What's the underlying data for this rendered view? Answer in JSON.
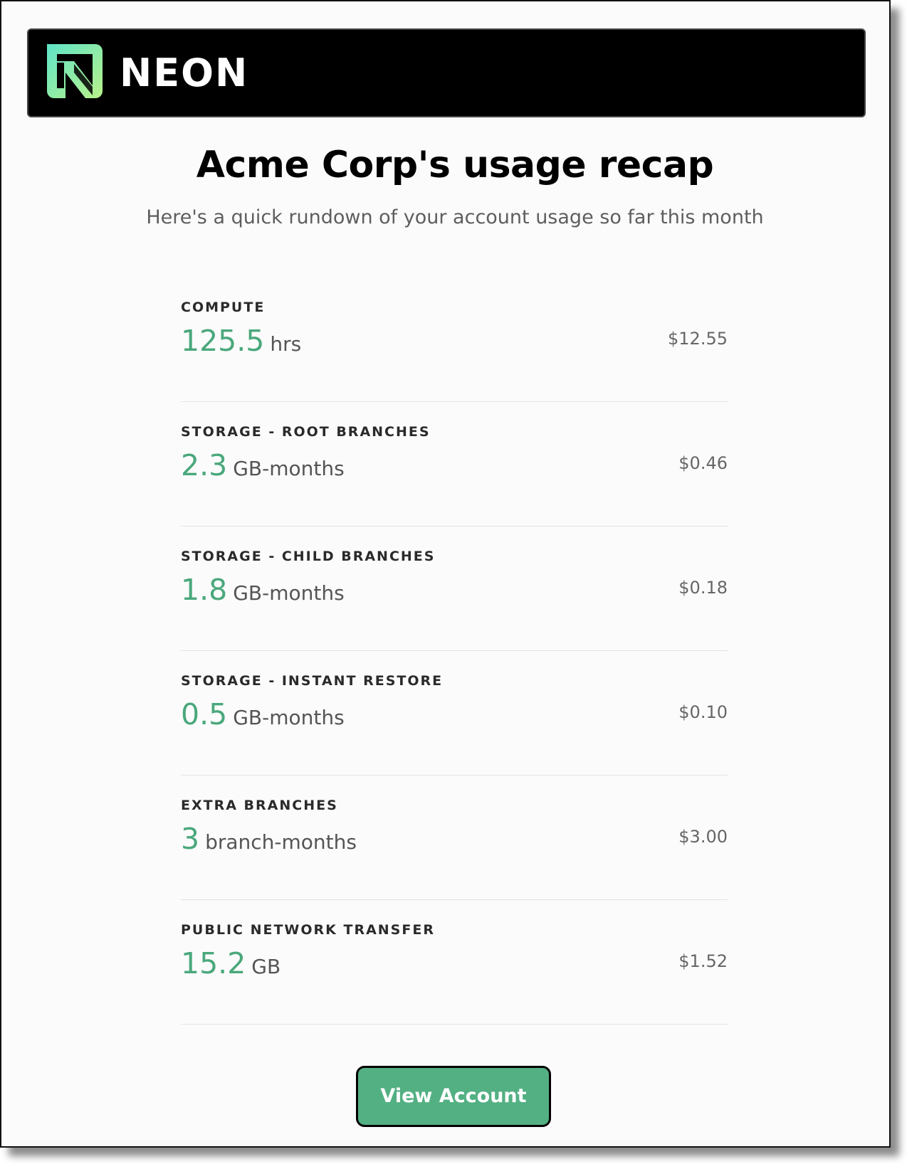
{
  "brand": {
    "name": "NEON",
    "logo_icon": "neon-n-logo-icon",
    "colors": {
      "header_bg": "#000000",
      "accent_green": "#4aa87c",
      "button_bg": "#53b083",
      "logo_gradient_start": "#5fe4c8",
      "logo_gradient_end": "#b8f28a"
    }
  },
  "title": "Acme Corp's usage recap",
  "subtitle": "Here's a quick rundown of your account usage so far this month",
  "usage": [
    {
      "label": "COMPUTE",
      "value": "125.5",
      "unit": "hrs",
      "cost": "$12.55"
    },
    {
      "label": "STORAGE - ROOT BRANCHES",
      "value": "2.3",
      "unit": "GB-months",
      "cost": "$0.46"
    },
    {
      "label": "STORAGE - CHILD BRANCHES",
      "value": "1.8",
      "unit": "GB-months",
      "cost": "$0.18"
    },
    {
      "label": "STORAGE - INSTANT RESTORE",
      "value": "0.5",
      "unit": "GB-months",
      "cost": "$0.10"
    },
    {
      "label": "EXTRA BRANCHES",
      "value": "3",
      "unit": "branch-months",
      "cost": "$3.00"
    },
    {
      "label": "PUBLIC NETWORK TRANSFER",
      "value": "15.2",
      "unit": "GB",
      "cost": "$1.52"
    }
  ],
  "cta": {
    "label": "View Account"
  }
}
